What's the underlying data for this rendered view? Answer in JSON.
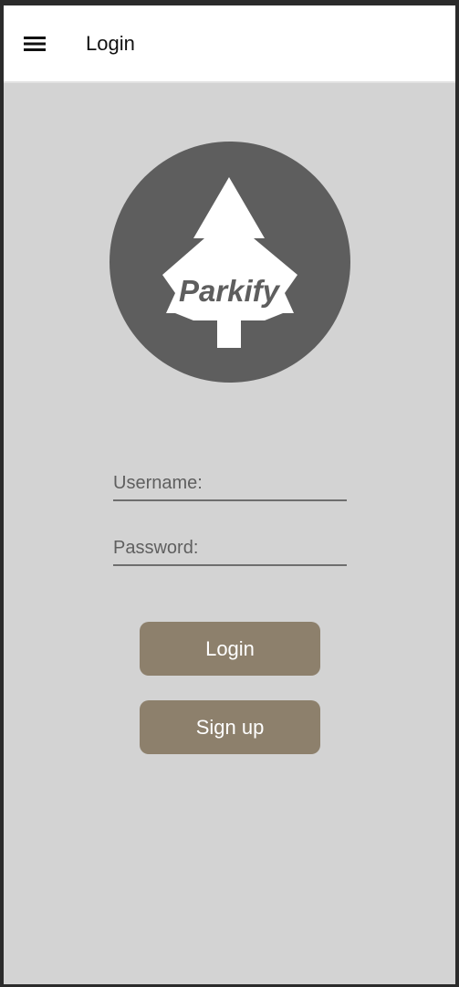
{
  "appbar": {
    "title": "Login",
    "menu_icon": "hamburger-menu-icon"
  },
  "logo": {
    "brand_text": "Parkify",
    "icon": "pine-tree-icon",
    "circle_color": "#5e5e5e"
  },
  "form": {
    "username_placeholder": "Username:",
    "password_placeholder": "Password:"
  },
  "buttons": {
    "login_label": "Login",
    "signup_label": "Sign up",
    "color": "#8d806c"
  },
  "colors": {
    "background": "#d3d3d3",
    "appbar": "#ffffff"
  }
}
